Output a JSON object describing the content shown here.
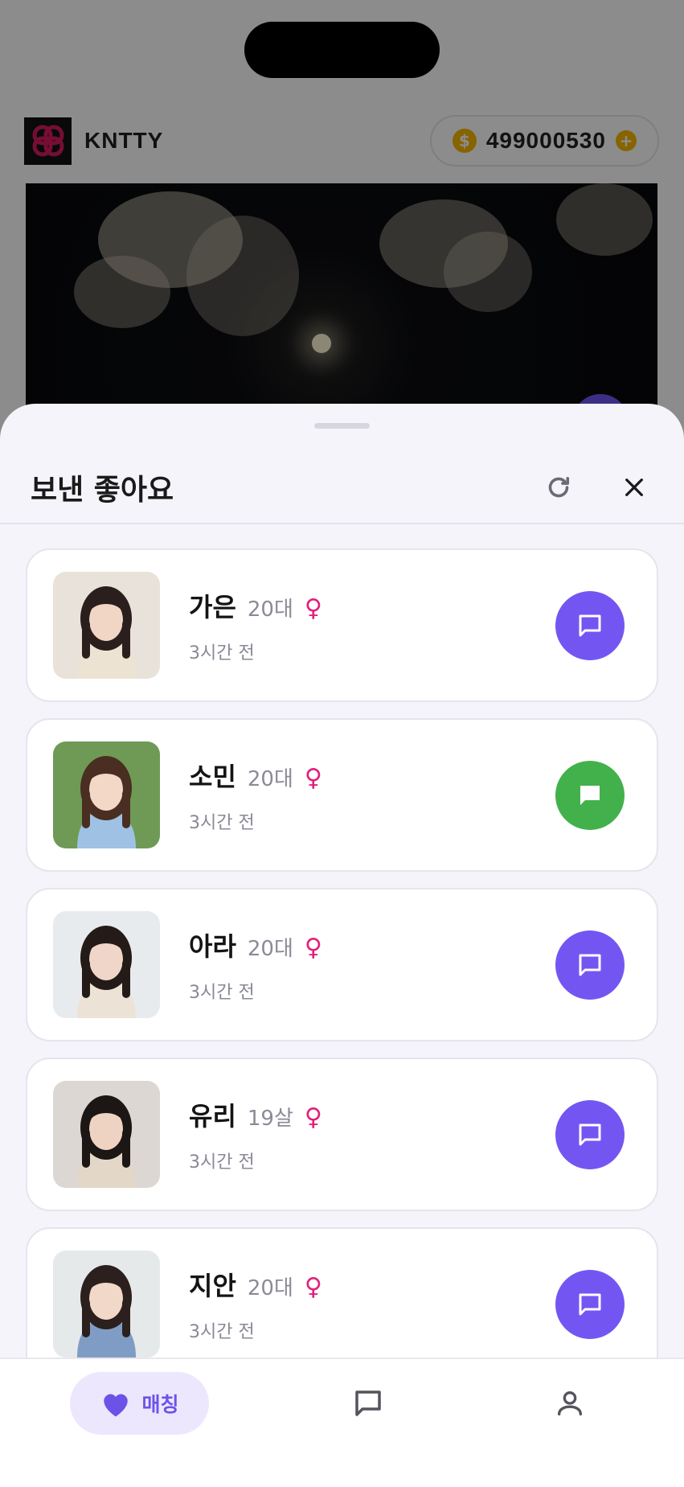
{
  "app": {
    "brand_name": "KNTTY",
    "coin_symbol": "$",
    "coin_balance": "499000530",
    "coin_add_symbol": "+"
  },
  "sheet": {
    "title": "보낸 좋아요"
  },
  "likes": [
    {
      "name": "가은",
      "age": "20대",
      "gender": "♀",
      "time": "3시간 전",
      "chat_active": false,
      "avatar": {
        "bg": "#e9e2da",
        "hair": "#2a1f1c",
        "skin": "#f1d6c6",
        "top": "#ede3d3"
      }
    },
    {
      "name": "소민",
      "age": "20대",
      "gender": "♀",
      "time": "3시간 전",
      "chat_active": true,
      "avatar": {
        "bg": "#6f9a55",
        "hair": "#4a2e22",
        "skin": "#f3d8c8",
        "top": "#9fc2e4"
      }
    },
    {
      "name": "아라",
      "age": "20대",
      "gender": "♀",
      "time": "3시간 전",
      "chat_active": false,
      "avatar": {
        "bg": "#e8ebee",
        "hair": "#241b18",
        "skin": "#f0d6c8",
        "top": "#ece3d6"
      }
    },
    {
      "name": "유리",
      "age": "19살",
      "gender": "♀",
      "time": "3시간 전",
      "chat_active": false,
      "avatar": {
        "bg": "#dcd7d2",
        "hair": "#1c1614",
        "skin": "#efd3c2",
        "top": "#e3d8c8"
      }
    },
    {
      "name": "지안",
      "age": "20대",
      "gender": "♀",
      "time": "3시간 전",
      "chat_active": false,
      "avatar": {
        "bg": "#e6e9ea",
        "hair": "#2b201d",
        "skin": "#f2d8c9",
        "top": "#7f9dc4"
      }
    }
  ],
  "bottom_nav": {
    "match_label": "매칭"
  },
  "colors": {
    "accent": "#7356f2",
    "active_chat": "#43b14b",
    "gender_female": "#e0207a",
    "coin": "#f5b700"
  },
  "icons": {
    "refresh": "refresh-icon",
    "close": "close-icon",
    "chat": "chat-bubble-icon",
    "heart": "heart-icon",
    "profile": "person-icon"
  }
}
